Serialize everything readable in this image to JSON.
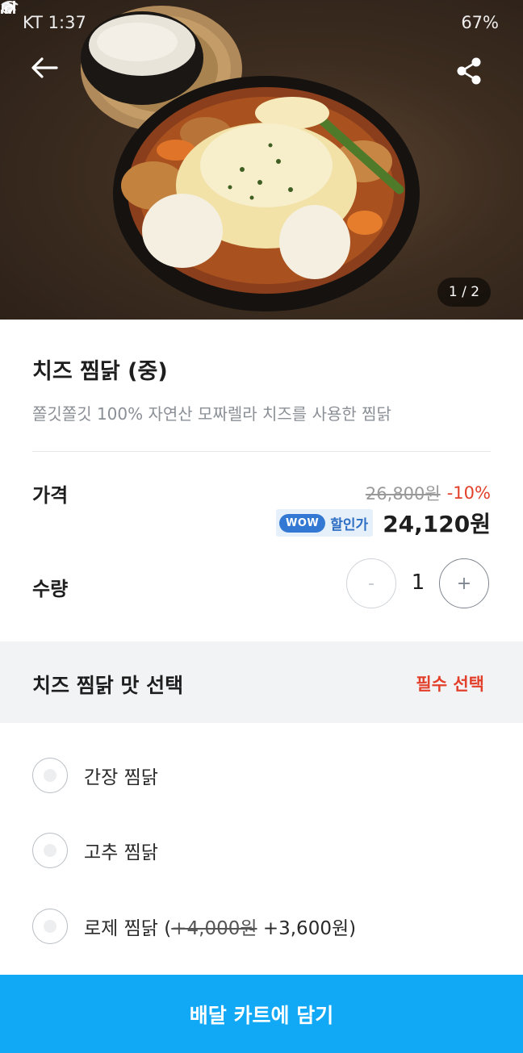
{
  "status_bar": {
    "carrier_time": "KT 1:37",
    "battery": "67%"
  },
  "hero": {
    "pager": "1 / 2"
  },
  "product": {
    "title": "치즈 찜닭 (중)",
    "description": "쫄깃쫄깃 100% 자연산 모짜렐라 치즈를 사용한 찜닭"
  },
  "price": {
    "label": "가격",
    "original": "26,800원",
    "discount": "-10%",
    "wow_badge": "WOW",
    "wow_text": "할인가",
    "sale": "24,120원"
  },
  "quantity": {
    "label": "수량",
    "minus": "-",
    "value": "1",
    "plus": "+"
  },
  "option_group": {
    "title": "치즈 찜닭 맛 선택",
    "required": "필수 선택",
    "options": [
      {
        "label": "간장 찜닭"
      },
      {
        "label": "고추 찜닭"
      },
      {
        "label_prefix": "로제 찜닭 (",
        "label_strike": "+4,000원",
        "label_suffix": " +3,600원)"
      }
    ]
  },
  "cta": {
    "label": "배달 카트에 담기"
  },
  "colors": {
    "accent": "#11a9f5",
    "discount_red": "#e2402b",
    "wow_blue": "#3378d3"
  },
  "icons": [
    "back-arrow-icon",
    "share-icon",
    "wifi-icon",
    "signal-icon",
    "mute-icon",
    "alarm-icon"
  ]
}
